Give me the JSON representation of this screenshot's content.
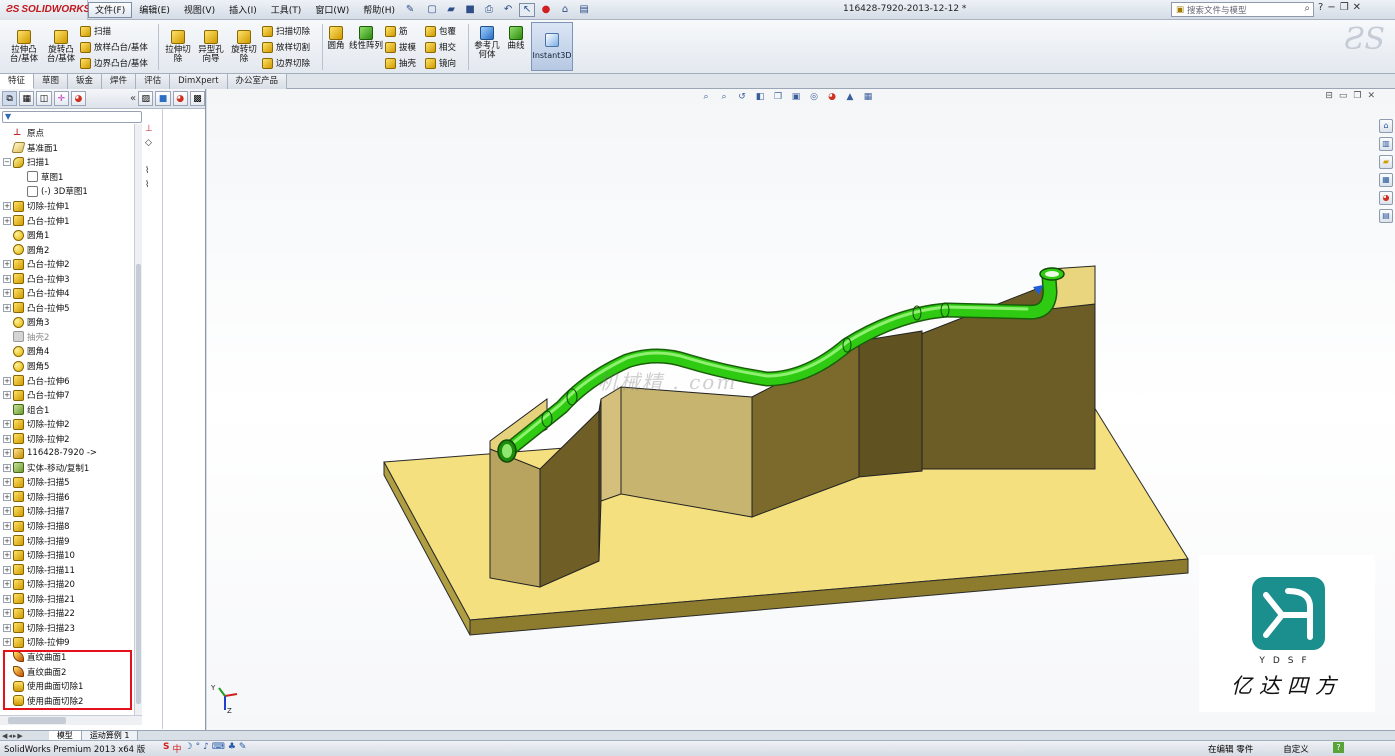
{
  "app": {
    "logo_text": "SOLIDWORKS",
    "doc_title": "116428-7920-2013-12-12 *"
  },
  "menu": [
    "文件(F)",
    "编辑(E)",
    "视图(V)",
    "插入(I)",
    "工具(T)",
    "窗口(W)",
    "帮助(H)"
  ],
  "search": {
    "placeholder": "搜索文件与模型"
  },
  "ribbon": {
    "extrude_boss": "拉伸凸台/基体",
    "revolve_boss": "旋转凸台/基体",
    "sweep": "扫描",
    "loft_boss": "放样凸台/基体",
    "boundary_boss": "边界凸台/基体",
    "extrude_cut": "拉伸切除",
    "hole_wizard": "异型孔向导",
    "revolve_cut": "旋转切除",
    "sweep_cut": "扫描切除",
    "loft_cut": "放样切割",
    "boundary_cut": "边界切除",
    "fillet": "圆角",
    "linear_pattern": "线性阵列",
    "rib": "筋",
    "draft": "拔模",
    "shell": "抽壳",
    "wrap": "包覆",
    "intersect": "相交",
    "mirror": "镜向",
    "ref_geometry": "参考几何体",
    "curves": "曲线",
    "instant3d": "Instant3D"
  },
  "tabs": [
    "特征",
    "草图",
    "钣金",
    "焊件",
    "评估",
    "DimXpert",
    "办公室产品"
  ],
  "tree": [
    {
      "label": "原点",
      "icon": "org",
      "exp": false,
      "indent": 0
    },
    {
      "label": "基准面1",
      "icon": "pl",
      "exp": false,
      "indent": 0
    },
    {
      "label": "扫描1",
      "icon": "sweep",
      "exp": true,
      "expsym": "−",
      "indent": 0
    },
    {
      "label": "草图1",
      "icon": "sk",
      "exp": false,
      "indent": 1
    },
    {
      "label": "(-) 3D草图1",
      "icon": "sk",
      "exp": false,
      "indent": 1
    },
    {
      "label": "切除-拉伸1",
      "icon": "fold",
      "exp": true,
      "indent": 0
    },
    {
      "label": "凸台-拉伸1",
      "icon": "fold",
      "exp": true,
      "indent": 0
    },
    {
      "label": "圆角1",
      "icon": "fil",
      "exp": false,
      "indent": 0
    },
    {
      "label": "圆角2",
      "icon": "fil",
      "exp": false,
      "indent": 0
    },
    {
      "label": "凸台-拉伸2",
      "icon": "fold",
      "exp": true,
      "indent": 0
    },
    {
      "label": "凸台-拉伸3",
      "icon": "fold",
      "exp": true,
      "indent": 0
    },
    {
      "label": "凸台-拉伸4",
      "icon": "fold",
      "exp": true,
      "indent": 0
    },
    {
      "label": "凸台-拉伸5",
      "icon": "fold",
      "exp": true,
      "indent": 0
    },
    {
      "label": "圆角3",
      "icon": "fil",
      "exp": false,
      "indent": 0
    },
    {
      "label": "抽壳2",
      "icon": "grey",
      "exp": false,
      "indent": 0,
      "grey": true
    },
    {
      "label": "圆角4",
      "icon": "fil",
      "exp": false,
      "indent": 0
    },
    {
      "label": "圆角5",
      "icon": "fil",
      "exp": false,
      "indent": 0
    },
    {
      "label": "凸台-拉伸6",
      "icon": "fold",
      "exp": true,
      "indent": 0
    },
    {
      "label": "凸台-拉伸7",
      "icon": "fold",
      "exp": true,
      "indent": 0
    },
    {
      "label": "组合1",
      "icon": "move",
      "exp": false,
      "indent": 0
    },
    {
      "label": "切除-拉伸2",
      "icon": "fold",
      "exp": true,
      "indent": 0
    },
    {
      "label": "切除-拉伸2",
      "icon": "fold",
      "exp": true,
      "indent": 0
    },
    {
      "label": "116428-7920 ->",
      "icon": "body",
      "exp": true,
      "indent": 0
    },
    {
      "label": "实体-移动/复制1",
      "icon": "move",
      "exp": true,
      "indent": 0
    },
    {
      "label": "切除-扫描5",
      "icon": "fold",
      "exp": true,
      "indent": 0
    },
    {
      "label": "切除-扫描6",
      "icon": "fold",
      "exp": true,
      "indent": 0
    },
    {
      "label": "切除-扫描7",
      "icon": "fold",
      "exp": true,
      "indent": 0
    },
    {
      "label": "切除-扫描8",
      "icon": "fold",
      "exp": true,
      "indent": 0
    },
    {
      "label": "切除-扫描9",
      "icon": "fold",
      "exp": true,
      "indent": 0
    },
    {
      "label": "切除-扫描10",
      "icon": "fold",
      "exp": true,
      "indent": 0
    },
    {
      "label": "切除-扫描11",
      "icon": "fold",
      "exp": true,
      "indent": 0
    },
    {
      "label": "切除-扫描20",
      "icon": "fold",
      "exp": true,
      "indent": 0
    },
    {
      "label": "切除-扫描21",
      "icon": "fold",
      "exp": true,
      "indent": 0
    },
    {
      "label": "切除-扫描22",
      "icon": "fold",
      "exp": true,
      "indent": 0
    },
    {
      "label": "切除-扫描23",
      "icon": "fold",
      "exp": true,
      "indent": 0
    },
    {
      "label": "切除-拉伸9",
      "icon": "fold",
      "exp": true,
      "indent": 0
    },
    {
      "label": "直纹曲面1",
      "icon": "wrap",
      "exp": false,
      "indent": 0
    },
    {
      "label": "直纹曲面2",
      "icon": "wrap",
      "exp": false,
      "indent": 0
    },
    {
      "label": "使用曲面切除1",
      "icon": "cutsrf",
      "exp": false,
      "indent": 0
    },
    {
      "label": "使用曲面切除2",
      "icon": "cutsrf",
      "exp": false,
      "indent": 0
    }
  ],
  "viewport": {
    "watermark": "机械精 . com",
    "logo_letters": "YDSF",
    "logo_cn": "亿达四方",
    "triad_y": "Y",
    "triad_z": "Z"
  },
  "bottom_tabs": [
    "模型",
    "运动算例 1"
  ],
  "status": {
    "left": "SolidWorks Premium 2013 x64 版",
    "editing": "在编辑 零件",
    "custom": "自定义",
    "ime_s": "S",
    "ime_zh": "中"
  },
  "colors": {
    "base": "#f0dc7a",
    "block": "#c9b46a",
    "pipe": "#2ecb12",
    "logo": "#1b8e8e"
  }
}
